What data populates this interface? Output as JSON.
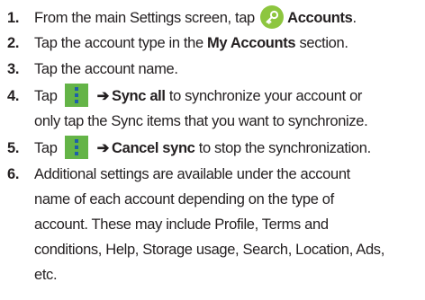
{
  "steps": [
    {
      "number": "1.",
      "text_before": "From the main Settings screen, tap",
      "icon": "accounts-key-icon",
      "bold": "Accounts",
      "text_after": "."
    },
    {
      "number": "2.",
      "text_before": "Tap the account type in the",
      "bold": "My Accounts",
      "text_after": "section."
    },
    {
      "number": "3.",
      "text": "Tap the account name."
    },
    {
      "number": "4.",
      "text_before": "Tap",
      "icon": "menu-icon",
      "arrow": "➔",
      "bold": "Sync all",
      "text_after": "to synchronize your account or",
      "line2": "only tap the Sync items that you want to synchronize."
    },
    {
      "number": "5.",
      "text_before": "Tap",
      "icon": "menu-icon",
      "arrow": "➔",
      "bold": "Cancel sync",
      "text_after": "to stop the synchronization."
    },
    {
      "number": "6.",
      "lines": [
        "Additional settings are available under the account",
        "name of each account depending on the type of",
        "account. These may include Profile, Terms and",
        "conditions, Help, Storage usage, Search, Location, Ads,",
        "etc."
      ]
    }
  ],
  "colors": {
    "text": "#231f20",
    "accounts_icon": "#8dc63f",
    "menu_icon_bg": "#64b447",
    "menu_icon_dots": "#1e5fa8"
  }
}
